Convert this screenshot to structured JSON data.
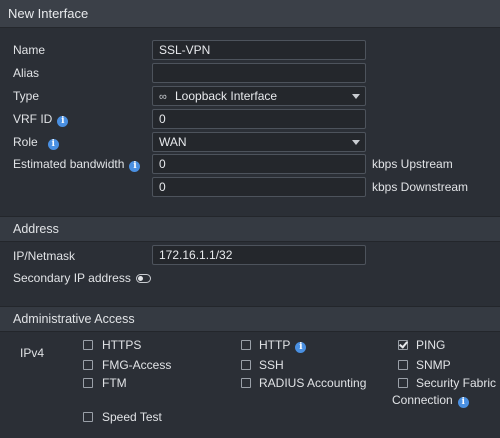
{
  "window": {
    "title": "New Interface"
  },
  "form": {
    "name": {
      "label": "Name",
      "value": "SSL-VPN"
    },
    "alias": {
      "label": "Alias",
      "value": ""
    },
    "type": {
      "label": "Type",
      "value": "Loopback Interface"
    },
    "vrf_id": {
      "label": "VRF ID",
      "value": "0"
    },
    "role": {
      "label": "Role",
      "value": "WAN"
    },
    "bandwidth": {
      "label": "Estimated bandwidth",
      "upstream_value": "0",
      "upstream_unit": "kbps Upstream",
      "downstream_value": "0",
      "downstream_unit": "kbps Downstream"
    }
  },
  "address": {
    "section_title": "Address",
    "ip_netmask": {
      "label": "IP/Netmask",
      "value": "172.16.1.1/32"
    },
    "secondary_ip": {
      "label": "Secondary IP address",
      "enabled": false
    }
  },
  "admin_access": {
    "section_title": "Administrative Access",
    "ipv4_label": "IPv4",
    "options": {
      "https": {
        "label": "HTTPS",
        "checked": false
      },
      "http": {
        "label": "HTTP",
        "checked": false
      },
      "ping": {
        "label": "PING",
        "checked": true
      },
      "fmg": {
        "label": "FMG-Access",
        "checked": false
      },
      "ssh": {
        "label": "SSH",
        "checked": false
      },
      "snmp": {
        "label": "SNMP",
        "checked": false
      },
      "ftm": {
        "label": "FTM",
        "checked": false
      },
      "radius": {
        "label": "RADIUS Accounting",
        "checked": false
      },
      "sfc": {
        "label_line1": "Security Fabric",
        "label_line2": "Connection",
        "checked": false
      },
      "speed": {
        "label": "Speed Test",
        "checked": false
      }
    }
  },
  "colors": {
    "background": "#2b2f36",
    "input_bg": "#24272c",
    "info_icon": "#4a90e2"
  }
}
